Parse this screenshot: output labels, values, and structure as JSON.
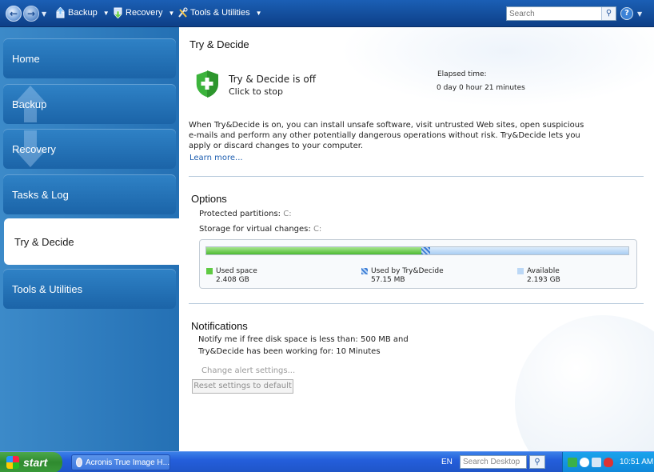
{
  "toolbar": {
    "backup_label": "Backup",
    "recovery_label": "Recovery",
    "tools_label": "Tools & Utilities",
    "search_placeholder": "Search"
  },
  "sidebar": {
    "items": [
      {
        "label": "Home"
      },
      {
        "label": "Backup"
      },
      {
        "label": "Recovery"
      },
      {
        "label": "Tasks & Log"
      },
      {
        "label": "Try & Decide",
        "active": true
      },
      {
        "label": "Tools & Utilities"
      }
    ]
  },
  "main": {
    "title": "Try & Decide",
    "status": "Try & Decide is off",
    "click_to_stop": "Click to stop",
    "elapsed_label": "Elapsed time:",
    "elapsed_value": "0 day 0 hour 21 minutes",
    "description": "When Try&Decide is on, you can install unsafe software, visit untrusted Web sites, open suspicious e-mails and perform any other potentially dangerous operations without risk. Try&Decide lets you apply or discard changes to your computer.",
    "learn_more": "Learn more...",
    "options": {
      "heading": "Options",
      "protected_label": "Protected partitions:",
      "protected_value": "C:",
      "storage_label": "Storage for virtual changes:",
      "storage_value": "C:"
    },
    "usage": {
      "used_label": "Used space",
      "used_value": "2.408 GB",
      "td_label": "Used by Try&Decide",
      "td_value": "57.15 MB",
      "available_label": "Available",
      "available_value": "2.193 GB",
      "used_fraction": 0.51,
      "td_fraction": 0.02,
      "available_fraction": 0.47,
      "colors": {
        "used": "#4dbb32",
        "td": "#3a7bd5",
        "available": "#a9cdf3"
      }
    },
    "notifications": {
      "heading": "Notifications",
      "line1": "Notify me if free disk space is less than: 500 MB and",
      "line2": "Try&Decide has been working for: 10 Minutes",
      "change_alert": "Change alert settings...",
      "reset_button": "Reset settings to default"
    }
  },
  "taskbar": {
    "start_label": "start",
    "task_label": "Acronis True Image H...",
    "language": "EN",
    "search_placeholder": "Search Desktop",
    "clock": "10:51 AM"
  },
  "colors": {
    "accent": "#1b5fb5",
    "sidebar": "#2470b4",
    "link": "#1f5fb0"
  }
}
